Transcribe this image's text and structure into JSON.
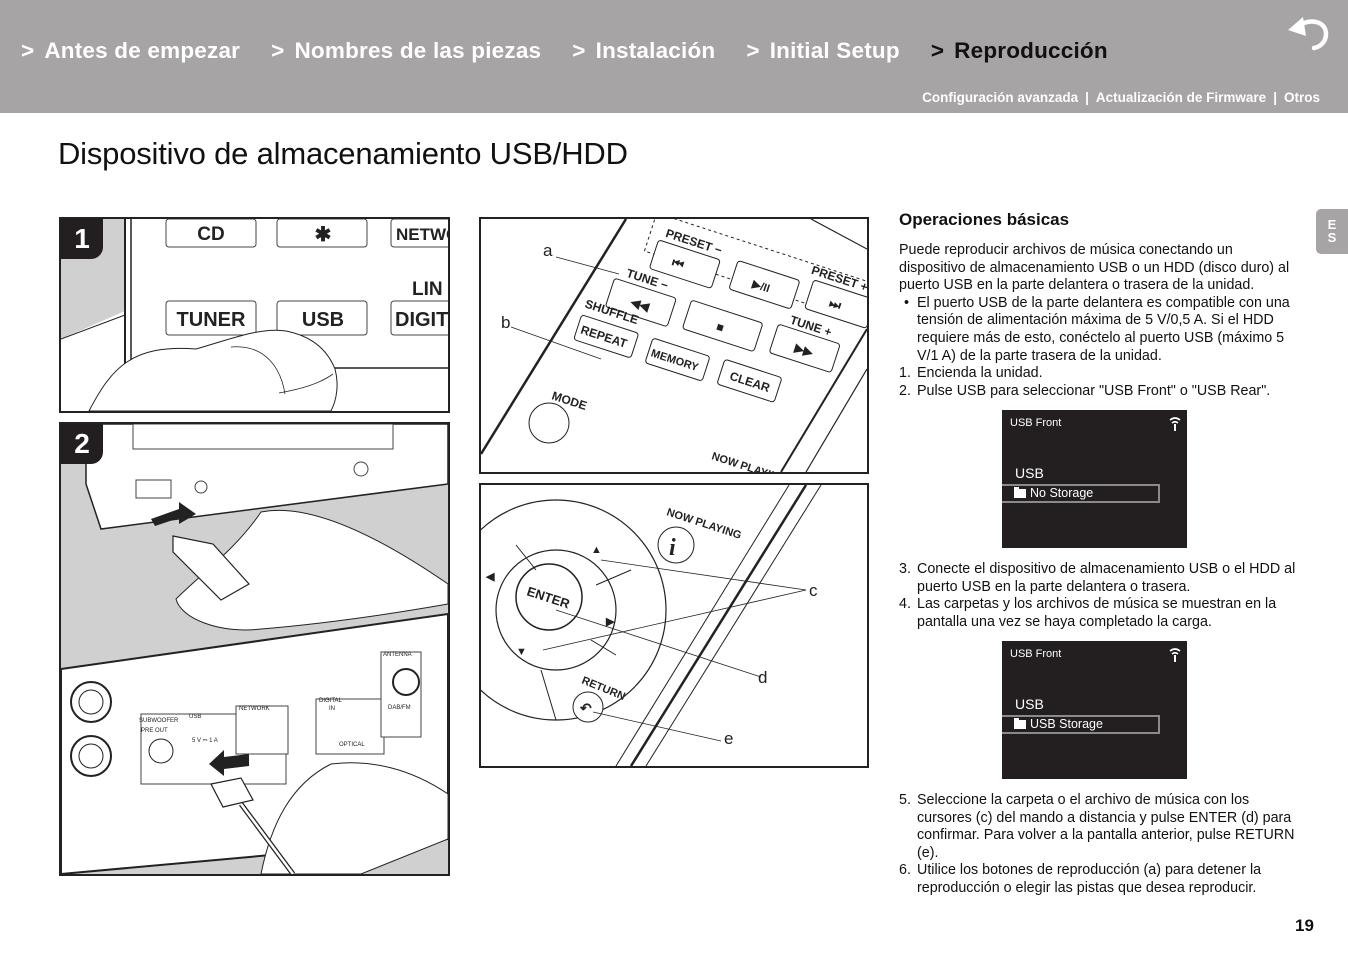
{
  "header": {
    "nav": [
      {
        "label": "Antes de empezar",
        "active": false
      },
      {
        "label": "Nombres de las piezas",
        "active": false
      },
      {
        "label": "Instalación",
        "active": false
      },
      {
        "label": "Initial Setup",
        "active": false
      },
      {
        "label": "Reproducción",
        "active": true
      }
    ],
    "nav_prefix": ">",
    "subnav": [
      "Configuración avanzada",
      "Actualización de Firmware",
      "Otros"
    ],
    "subnav_separator": "|",
    "back_icon": "return-arrow-icon"
  },
  "page": {
    "title": "Dispositivo de almacenamiento USB/HDD",
    "language_tab": [
      "E",
      "S"
    ],
    "page_number": "19"
  },
  "figures": {
    "step1": {
      "badge": "1",
      "buttons": [
        "CD",
        "Bluetooth",
        "NETWO",
        "LIN",
        "TUNER",
        "USB",
        "DIGIT"
      ]
    },
    "step2": {
      "badge": "2",
      "rear_labels": [
        "SUBWOOFER",
        "PRE OUT",
        "USB",
        "5 V ⎓ 1 A",
        "NETWORK",
        "DIGITAL",
        "IN",
        "OPTICAL",
        "ANTENNA",
        "DAB/FM"
      ]
    },
    "remote_top": {
      "callouts": [
        "a",
        "b"
      ],
      "buttons": [
        "PRESET −",
        "PRESET +",
        "TUNE −",
        "TUNE +",
        "SHUFFLE",
        "REPEAT",
        "MEMORY",
        "CLEAR",
        "MODE",
        "NOW PLAYING"
      ]
    },
    "remote_bottom": {
      "callouts": [
        "c",
        "d",
        "e"
      ],
      "buttons": [
        "ENTER",
        "RETURN",
        "NOW PLAYING"
      ]
    }
  },
  "content": {
    "heading": "Operaciones básicas",
    "intro": "Puede reproducir archivos de música conectando un dispositivo de almacenamiento USB o un HDD (disco duro) al puerto USB en la parte delantera o trasera de la unidad.",
    "bullet": "El puerto USB de la parte delantera es compatible con una tensión de alimentación máxima de 5 V/0,5 A. Si el HDD requiere más de esto, conéctelo al puerto USB (máximo 5 V/1 A) de la parte trasera de la unidad.",
    "steps_a": [
      {
        "n": "1.",
        "text": "Encienda la unidad."
      },
      {
        "n": "2.",
        "text": "Pulse USB para seleccionar \"USB Front\" o \"USB Rear\"."
      }
    ],
    "display1": {
      "title": "USB Front",
      "heading": "USB",
      "item": "No Storage"
    },
    "steps_b": [
      {
        "n": "3.",
        "text": "Conecte el dispositivo de almacenamiento USB o el HDD al puerto USB en la parte delantera o trasera."
      },
      {
        "n": "4.",
        "text": "Las carpetas y los archivos de música se muestran en la pantalla una vez se haya completado la carga."
      }
    ],
    "display2": {
      "title": "USB Front",
      "heading": "USB",
      "item": "USB Storage"
    },
    "steps_c": [
      {
        "n": "5.",
        "text": "Seleccione la carpeta o el archivo de música con los cursores (c) del mando a distancia y pulse ENTER (d) para confirmar. Para volver a la pantalla anterior, pulse RETURN (e)."
      },
      {
        "n": "6.",
        "text": "Utilice los botones de reproducción (a) para detener la reproducción o elegir las pistas que desea reproducir."
      }
    ]
  }
}
